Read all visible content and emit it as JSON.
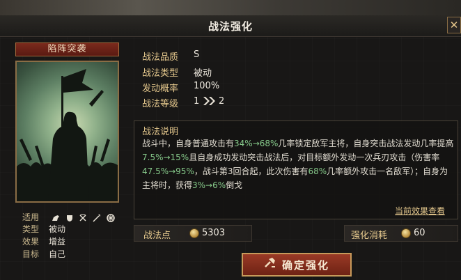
{
  "window": {
    "title": "战法强化"
  },
  "tactic": {
    "name": "陷阵突袭",
    "attributes": [
      {
        "key": "适用",
        "value": ""
      },
      {
        "key": "类型",
        "value": "被动"
      },
      {
        "key": "效果",
        "value": "增益"
      },
      {
        "key": "目标",
        "value": "自己"
      }
    ],
    "applies_icons": [
      "cavalry-icon",
      "shield-icon",
      "bow-icon",
      "spear-icon",
      "siege-icon"
    ]
  },
  "stats": {
    "quality_label": "战法品质",
    "quality_value": "S",
    "type_label": "战法类型",
    "type_value": "被动",
    "rate_label": "发动概率",
    "rate_value": "100%",
    "level_label": "战法等级",
    "level_from": "1",
    "level_to": "2"
  },
  "description": {
    "title": "战法说明",
    "segments": [
      {
        "t": "战斗中，自身普通攻击有",
        "g": false
      },
      {
        "t": "34%→68%",
        "g": true
      },
      {
        "t": "几率锁定敌军主将，自身突击战法发动几率提高",
        "g": false
      },
      {
        "t": "7.5%→15%",
        "g": true
      },
      {
        "t": "且自身成功发动突击战法后，对目标额外发动一次兵刃攻击（伤害率",
        "g": false
      },
      {
        "t": "47.5%→95%",
        "g": true
      },
      {
        "t": "，战斗第3回合起，此次伤害有",
        "g": false
      },
      {
        "t": "68%",
        "g": true
      },
      {
        "t": "几率额外攻击一名敌军）；自身为主将时，获得",
        "g": false
      },
      {
        "t": "3%→6%",
        "g": true
      },
      {
        "t": "倒戈",
        "g": false
      }
    ],
    "current_effect_link": "当前效果查看"
  },
  "resources": {
    "points_label": "战法点",
    "points_value": "5303",
    "cost_label": "强化消耗",
    "cost_value": "60"
  },
  "actions": {
    "confirm_label": "确定强化",
    "close_label": "✕"
  },
  "colors": {
    "accent_gold": "#e6c98e",
    "highlight_green": "#86c98a",
    "button_red": "#9a3a26"
  }
}
